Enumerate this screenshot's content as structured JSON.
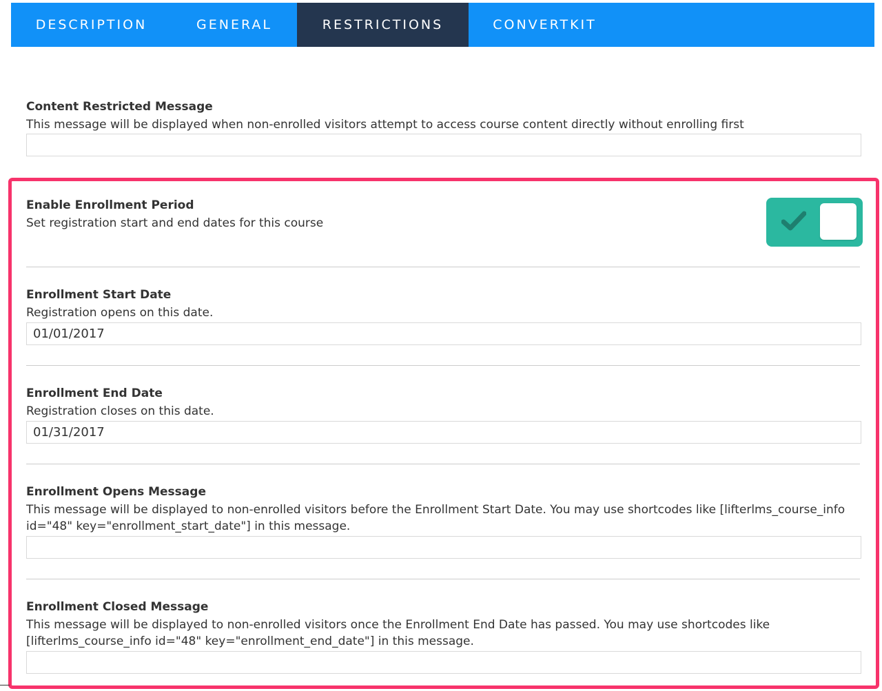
{
  "tabs": [
    {
      "label": "Description"
    },
    {
      "label": "General"
    },
    {
      "label": "Restrictions"
    },
    {
      "label": "ConvertKit"
    }
  ],
  "active_tab": "Restrictions",
  "content_restricted": {
    "label": "Content Restricted Message",
    "description": "This message will be displayed when non-enrolled visitors attempt to access course content directly without enrolling first",
    "value": ""
  },
  "enrollment_period": {
    "label": "Enable Enrollment Period",
    "description": "Set registration start and end dates for this course",
    "enabled": true
  },
  "start_date": {
    "label": "Enrollment Start Date",
    "description": "Registration opens on this date.",
    "value": "01/01/2017"
  },
  "end_date": {
    "label": "Enrollment End Date",
    "description": "Registration closes on this date.",
    "value": "01/31/2017"
  },
  "opens_message": {
    "label": "Enrollment Opens Message",
    "description_line1": "This message will be displayed to non-enrolled visitors before the Enrollment Start Date. You may use shortcodes like [lifterlms_course_info",
    "description_line2": "id=\"48\" key=\"enrollment_start_date\"] in this message.",
    "value": ""
  },
  "closed_message": {
    "label": "Enrollment Closed Message",
    "description_line1": "This message will be displayed to non-enrolled visitors once the Enrollment End Date has passed. You may use shortcodes like",
    "description_line2": "[lifterlms_course_info id=\"48\" key=\"enrollment_end_date\"] in this message.",
    "value": ""
  },
  "colors": {
    "tab_bar": "#1191f8",
    "tab_active": "#24364f",
    "toggle_on": "#2bb8a0",
    "highlight": "#f7336b"
  }
}
